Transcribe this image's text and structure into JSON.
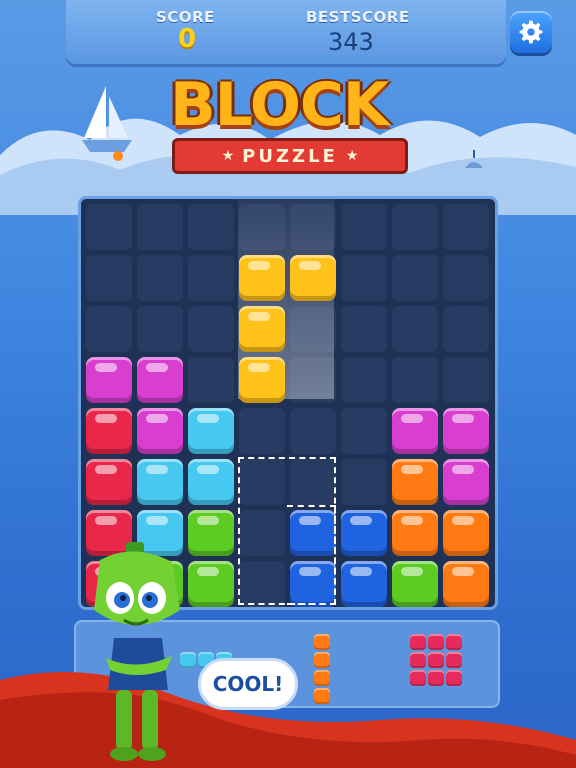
{
  "header": {
    "score_label": "SCORE",
    "score_value": "0",
    "best_label": "BESTSCORE",
    "best_value": "343",
    "settings_icon": "gear-icon"
  },
  "logo": {
    "title": "BLOCK",
    "subtitle": "PUZZLE"
  },
  "mascot": {
    "speech": "COOL!"
  },
  "colors": {
    "magenta": "#d93fcf",
    "red": "#e8274a",
    "cyan": "#46c8f0",
    "green": "#5ccb22",
    "blue": "#1f63e0",
    "orange": "#ff7a12",
    "yellow": "#ffc21a",
    "crimson": "#e62b5a"
  },
  "board": {
    "rows": 8,
    "cols": 8,
    "cells": [
      {
        "r": 1,
        "c": 3,
        "color": "yellow"
      },
      {
        "r": 1,
        "c": 4,
        "color": "yellow"
      },
      {
        "r": 2,
        "c": 3,
        "color": "yellow"
      },
      {
        "r": 3,
        "c": 3,
        "color": "yellow"
      },
      {
        "r": 3,
        "c": 0,
        "color": "magenta"
      },
      {
        "r": 3,
        "c": 1,
        "color": "magenta"
      },
      {
        "r": 4,
        "c": 0,
        "color": "red"
      },
      {
        "r": 4,
        "c": 1,
        "color": "magenta"
      },
      {
        "r": 4,
        "c": 2,
        "color": "cyan"
      },
      {
        "r": 4,
        "c": 6,
        "color": "magenta"
      },
      {
        "r": 4,
        "c": 7,
        "color": "magenta"
      },
      {
        "r": 5,
        "c": 0,
        "color": "red"
      },
      {
        "r": 5,
        "c": 1,
        "color": "cyan"
      },
      {
        "r": 5,
        "c": 2,
        "color": "cyan"
      },
      {
        "r": 5,
        "c": 6,
        "color": "orange"
      },
      {
        "r": 5,
        "c": 7,
        "color": "magenta"
      },
      {
        "r": 6,
        "c": 0,
        "color": "red"
      },
      {
        "r": 6,
        "c": 1,
        "color": "cyan"
      },
      {
        "r": 6,
        "c": 2,
        "color": "green"
      },
      {
        "r": 6,
        "c": 4,
        "color": "blue"
      },
      {
        "r": 6,
        "c": 5,
        "color": "blue"
      },
      {
        "r": 6,
        "c": 6,
        "color": "orange"
      },
      {
        "r": 6,
        "c": 7,
        "color": "orange"
      },
      {
        "r": 7,
        "c": 0,
        "color": "red"
      },
      {
        "r": 7,
        "c": 1,
        "color": "green"
      },
      {
        "r": 7,
        "c": 2,
        "color": "green"
      },
      {
        "r": 7,
        "c": 4,
        "color": "blue"
      },
      {
        "r": 7,
        "c": 5,
        "color": "blue"
      },
      {
        "r": 7,
        "c": 6,
        "color": "green"
      },
      {
        "r": 7,
        "c": 7,
        "color": "orange"
      }
    ]
  },
  "tray": {
    "pieces": [
      {
        "name": "cyan-bar-piece",
        "color": "cyan",
        "cells": [
          [
            0,
            0
          ],
          [
            0,
            1
          ],
          [
            0,
            2
          ]
        ]
      },
      {
        "name": "orange-vertical-piece",
        "color": "orange",
        "cells": [
          [
            0,
            0
          ],
          [
            1,
            0
          ],
          [
            2,
            0
          ],
          [
            3,
            0
          ]
        ]
      },
      {
        "name": "crimson-square-piece",
        "color": "crimson",
        "cells": [
          [
            0,
            0
          ],
          [
            0,
            1
          ],
          [
            0,
            2
          ],
          [
            1,
            0
          ],
          [
            1,
            1
          ],
          [
            1,
            2
          ],
          [
            2,
            0
          ],
          [
            2,
            1
          ],
          [
            2,
            2
          ]
        ]
      }
    ]
  }
}
